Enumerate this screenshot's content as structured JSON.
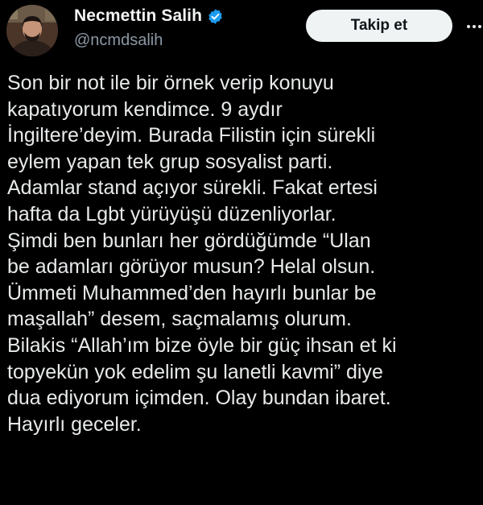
{
  "author": {
    "display_name": "Necmettin Salih",
    "handle": "@ncmdsalih",
    "verified_icon": "verified-badge-icon",
    "verified_color": "#1d9bf0"
  },
  "follow_button": {
    "label": "Takip et"
  },
  "more_menu": {
    "icon": "more-options-icon"
  },
  "tweet": {
    "lines": [
      "Son bir not ile bir örnek verip konuyu",
      "kapatıyorum kendimce. 9 aydır",
      "İngiltere’deyim. Burada Filistin için sürekli",
      "eylem yapan tek grup sosyalist parti.",
      "Adamlar stand açıyor sürekli. Fakat ertesi",
      "hafta da Lgbt yürüyüşü düzenliyorlar.",
      "Şimdi ben bunları her gördüğümde “Ulan",
      "be adamları görüyor musun? Helal olsun.",
      "Ümmeti Muhammed’den hayırlı bunlar be",
      "maşallah” desem, saçmalamış olurum.",
      "Bilakis “Allah’ım bize öyle bir güç ihsan et ki",
      "topyekün yok edelim şu lanetli kavmi” diye",
      "dua ediyorum içimden. Olay bundan ibaret.",
      "Hayırlı geceler."
    ]
  },
  "colors": {
    "background": "#000000",
    "text": "#e7e9ea",
    "secondary_text": "#8b98a5",
    "button_bg": "#eff3f4"
  }
}
